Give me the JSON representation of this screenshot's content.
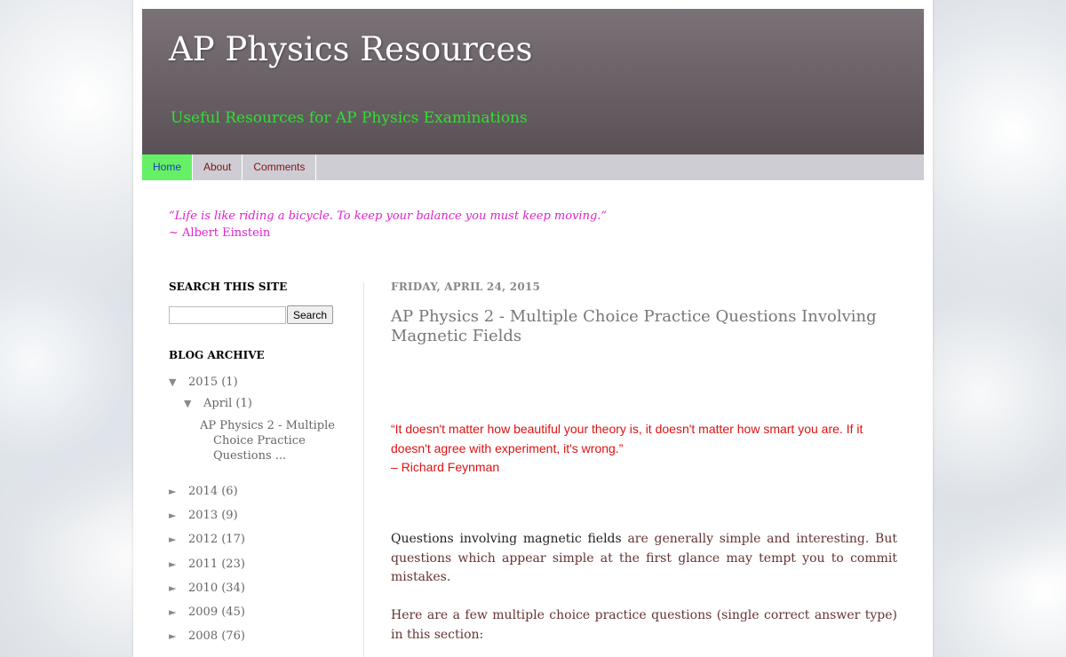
{
  "header": {
    "title": "AP Physics Resources",
    "description": "Useful Resources for AP Physics Examinations"
  },
  "tabs": [
    {
      "label": "Home",
      "active": true
    },
    {
      "label": "About",
      "active": false
    },
    {
      "label": "Comments",
      "active": false
    }
  ],
  "top_quote": {
    "text": "“Life is like riding a bicycle.  To keep your balance you must keep moving.”",
    "author": "~ Albert Einstein"
  },
  "sidebar": {
    "search_title": "SEARCH THIS SITE",
    "search_value": "",
    "search_button": "Search",
    "archive_title": "BLOG ARCHIVE",
    "archive": [
      {
        "year": "2015",
        "count": "(1)",
        "expanded": true
      },
      {
        "month": "April",
        "count": "(1)",
        "expanded": true
      },
      {
        "year": "2014",
        "count": "(6)",
        "expanded": false
      },
      {
        "year": "2013",
        "count": "(9)",
        "expanded": false
      },
      {
        "year": "2012",
        "count": "(17)",
        "expanded": false
      },
      {
        "year": "2011",
        "count": "(23)",
        "expanded": false
      },
      {
        "year": "2010",
        "count": "(34)",
        "expanded": false
      },
      {
        "year": "2009",
        "count": "(45)",
        "expanded": false
      },
      {
        "year": "2008",
        "count": "(76)",
        "expanded": false
      }
    ],
    "archive_post": "AP Physics 2 - Multiple Choice Practice Questions ..."
  },
  "post": {
    "date": "FRIDAY, APRIL 24, 2015",
    "title": "AP Physics 2 - Multiple Choice Practice Questions Involving Magnetic Fields",
    "quote_line1": "“It doesn't matter how beautiful your theory is, it doesn't matter how smart you are. If it doesn't agree with experiment, it's wrong.”",
    "quote_author": "– Richard Feynman",
    "para1_bold": "Questions involving magnetic fields",
    "para1_rest": " are generally simple and interesting. But questions which appear simple at the first glance may tempt you to commit mistakes.",
    "para2": "Here are a few multiple choice practice questions (single correct answer type) in this section:"
  },
  "colors": {
    "title": "#ffffff",
    "description": "#33dd33",
    "tab_active_bg": "#66f066",
    "top_quote": "#dd22cc",
    "feynman_quote": "#dd1111"
  }
}
